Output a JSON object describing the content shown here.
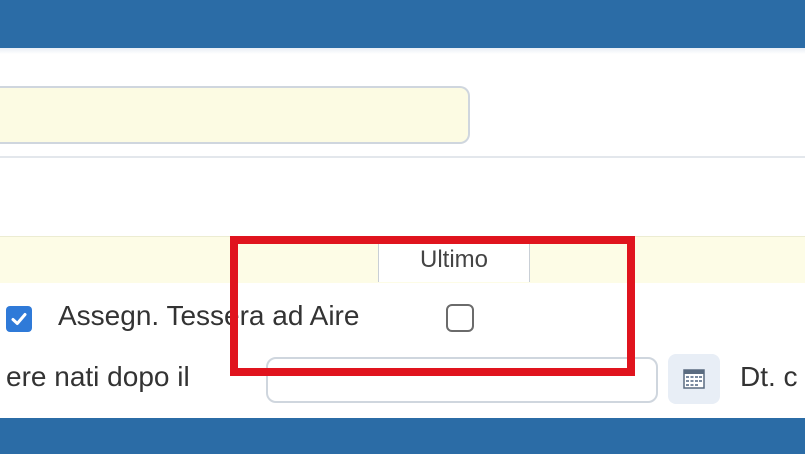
{
  "form": {
    "tab_ultimo": "Ultimo",
    "tessera_label": "Assegn. Tessera ad Aire",
    "nati_label": "ere nati dopo il",
    "dtc_label": "Dt. c",
    "first_checkbox_checked": true,
    "tessera_checkbox_checked": false
  },
  "icons": {
    "first_checkbox": "check-icon",
    "calendar": "calendar-icon"
  },
  "colors": {
    "header": "#2b6ca6",
    "input_fill": "#fcfbe3",
    "checkbox_accent": "#2f7ad8",
    "highlight": "#e0141e"
  }
}
